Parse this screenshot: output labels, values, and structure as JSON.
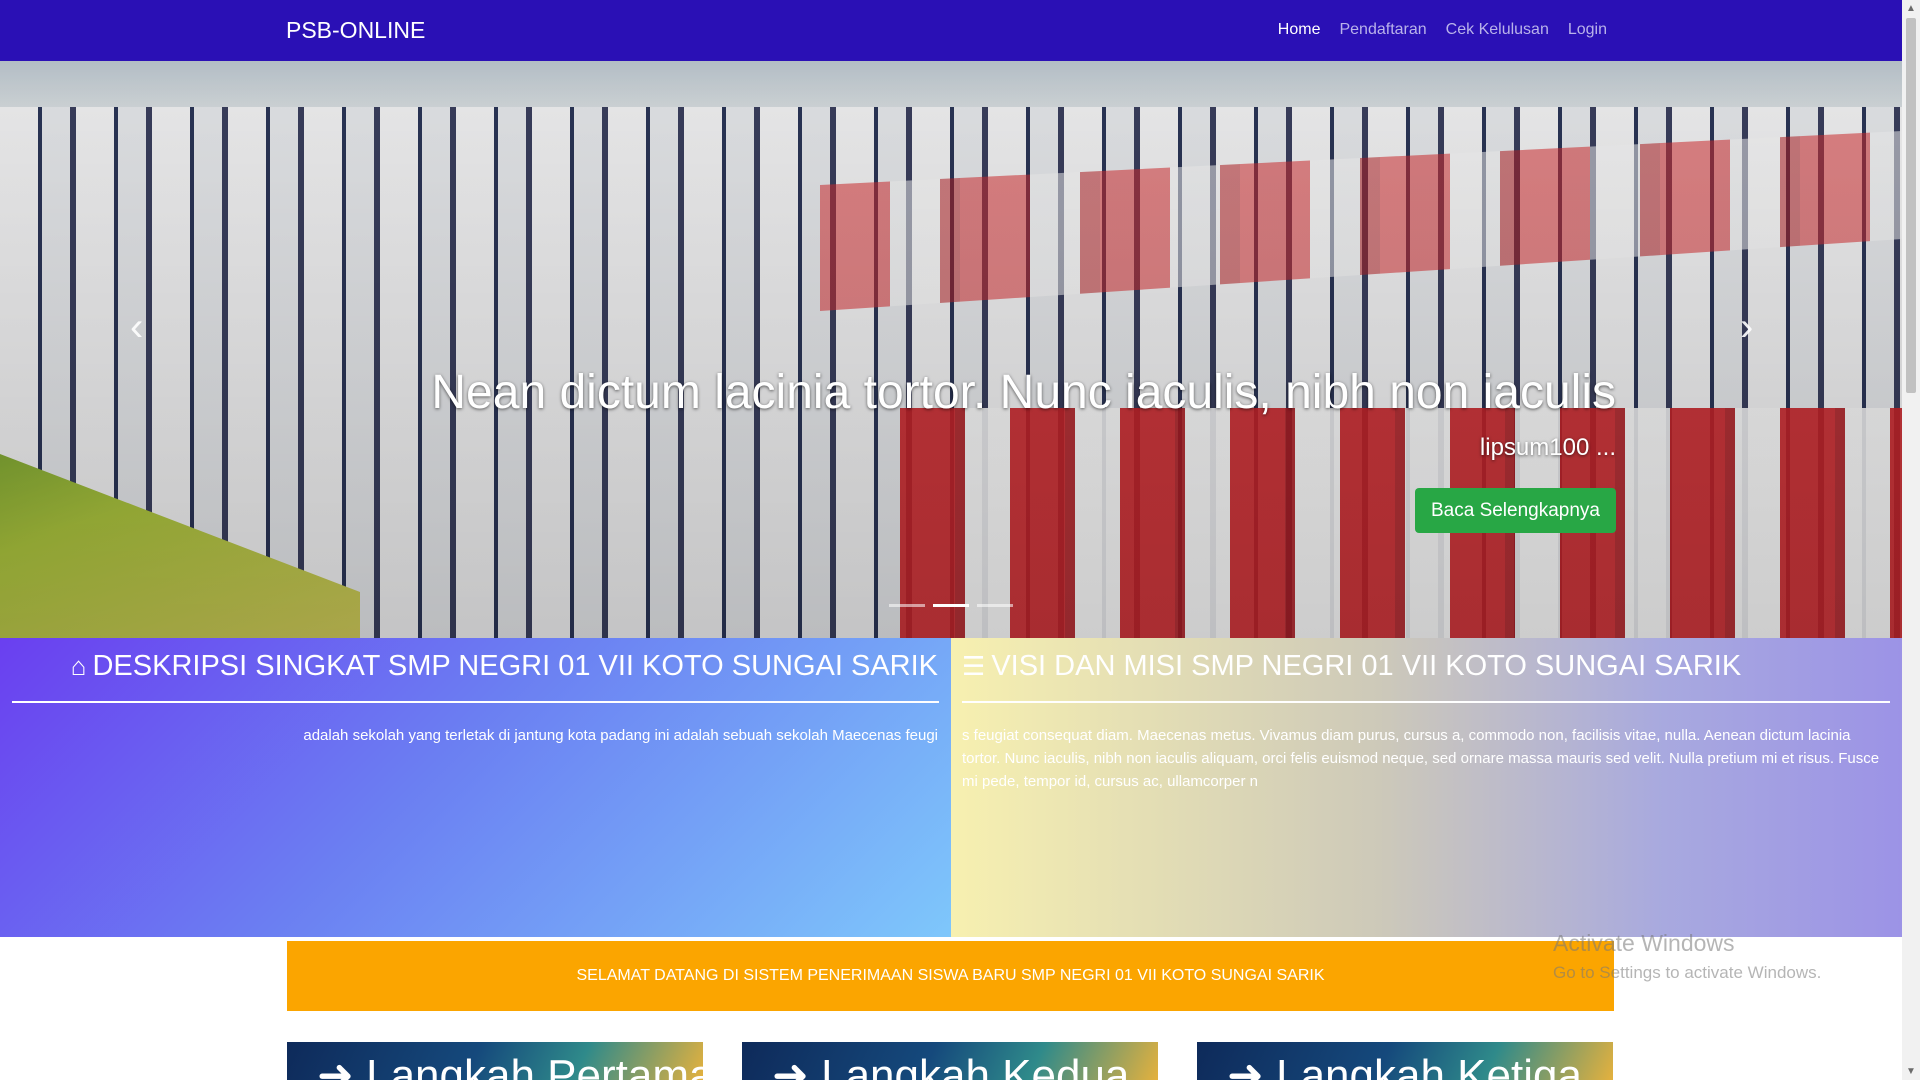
{
  "navbar": {
    "brand": "PSB-ONLINE",
    "items": [
      {
        "label": "Home",
        "active": true
      },
      {
        "label": "Pendaftaran"
      },
      {
        "label": "Cek Kelulusan"
      },
      {
        "label": "Login"
      }
    ]
  },
  "carousel": {
    "heading": "Nean dictum lacinia tortor. Nunc iaculis, nibh non iaculis",
    "subtext": "lipsum100 ...",
    "button_label": "Baca Selengkapnya",
    "prev_icon": "‹",
    "next_icon": "›",
    "active_slide": 2,
    "slide_count": 3
  },
  "panels": {
    "left": {
      "icon": "home-icon",
      "title": "DESKRIPSI SINGKAT SMP NEGRI 01 VII KOTO SUNGAI SARIK",
      "text": "adalah sekolah yang terletak di jantung kota padang ini adalah sebuah sekolah Maecenas feugi"
    },
    "right": {
      "icon": "list-icon",
      "title": "VISI DAN MISI SMP NEGRI 01 VII KOTO SUNGAI SARIK",
      "text": "s feugiat consequat diam. Maecenas metus. Vivamus diam purus, cursus a, commodo non, facilisis vitae, nulla. Aenean dictum lacinia tortor. Nunc iaculis, nibh non iaculis aliquam, orci felis euismod neque, sed ornare massa mauris sed velit. Nulla pretium mi et risus. Fusce mi pede, tempor id, cursus ac, ullamcorper n"
    }
  },
  "welcome": "SELAMAT DATANG DI SISTEM PENERIMAAN SISWA BARU SMP NEGRI 01 VII KOTO SUNGAI SARIK",
  "cards": [
    {
      "title": "Langkah Pertama"
    },
    {
      "title": "Langkah Kedua"
    },
    {
      "title": "Langkah Ketiga"
    }
  ],
  "watermark": {
    "line1": "Activate Windows",
    "line2": "Go to Settings to activate Windows."
  }
}
